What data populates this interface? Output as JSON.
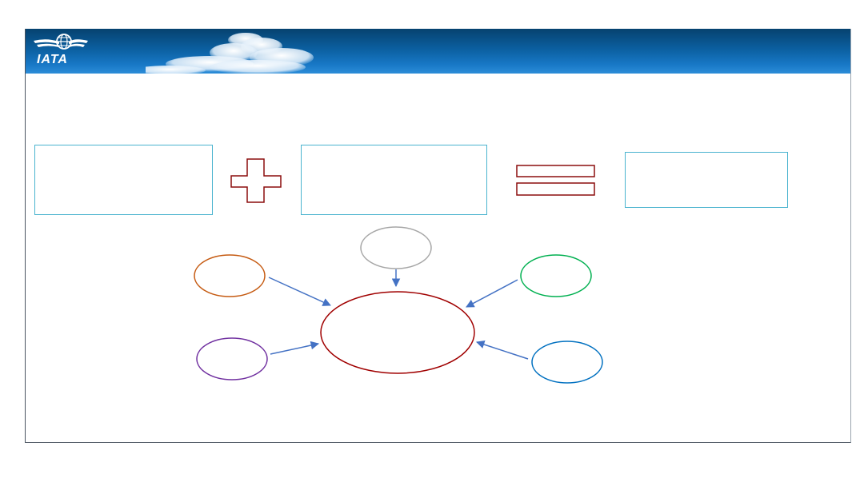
{
  "header": {
    "logo_text": "IATA"
  },
  "colors": {
    "banner_dark": "#06426f",
    "banner_light": "#2c8dd8",
    "box_border": "#4ab3cf",
    "operator_color": "#8b0d0d",
    "arrow_color": "#4472c4",
    "oval_top": "#a6a6a6",
    "oval_left_top": "#c55a11",
    "oval_left_bottom": "#7030a0",
    "oval_right_top": "#00b050",
    "oval_right_bottom": "#0070c0",
    "oval_center": "#a00000"
  },
  "icons": {
    "logo": "globe-wings-icon",
    "plus": "plus-icon",
    "equals": "equals-icon",
    "clouds": "cloud-icon"
  }
}
